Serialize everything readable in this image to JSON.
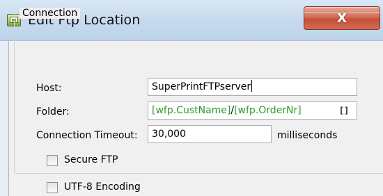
{
  "window": {
    "title": "Edit Ftp Location",
    "close_glyph": "X",
    "icon": "app-icon"
  },
  "connection": {
    "group_label": "Connection",
    "host": {
      "label": "Host:",
      "value": "SuperPrintFTPserver"
    },
    "folder": {
      "label": "Folder:",
      "value_part1": "[wfp.CustName]",
      "separator": "/",
      "value_part2": "[wfp.OrderNr]",
      "browse_button": "[]"
    },
    "timeout": {
      "label": "Connection Timeout:",
      "value": "30,000",
      "unit": "milliseconds"
    },
    "secure_ftp": {
      "label": "Secure FTP",
      "checked": false
    },
    "utf8": {
      "label": "UTF-8 Encoding",
      "checked": false
    }
  },
  "colors": {
    "variable_text": "#2e9a2e",
    "close_button": "#c74f37"
  }
}
